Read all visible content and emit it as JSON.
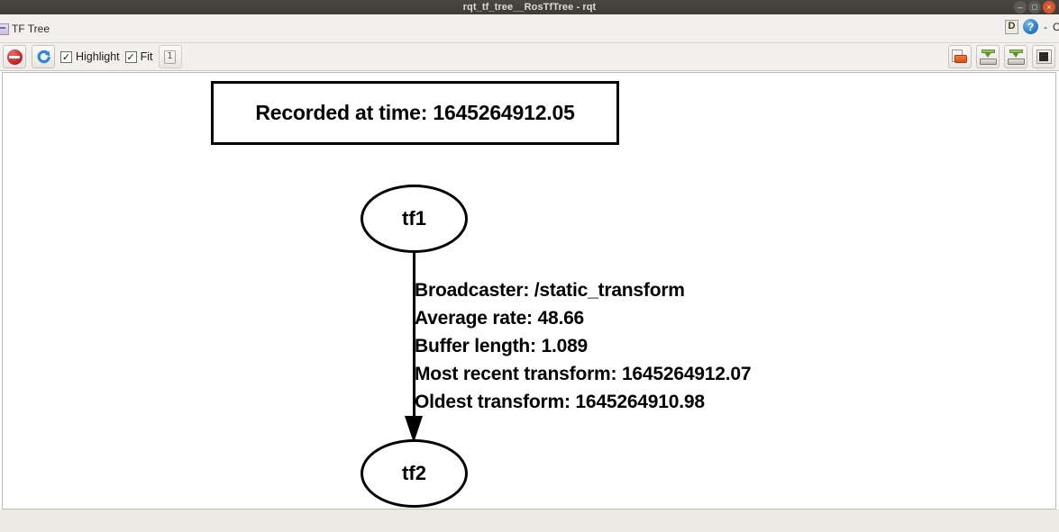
{
  "window": {
    "title": "rqt_tf_tree__RosTfTree - rqt",
    "controls": {
      "minimize": "–",
      "maximize": "□",
      "close": "×"
    }
  },
  "plugin_bar": {
    "tab_label": "TF Tree",
    "tab_icon": "plugin-icon",
    "dock_letter": "D",
    "help_icon": "?",
    "separator": "-",
    "trailing_text": "C"
  },
  "toolbar": {
    "left": [
      {
        "name": "stop-button",
        "icon": "stop-icon",
        "label": ""
      },
      {
        "name": "refresh-button",
        "icon": "refresh-icon",
        "label": ""
      }
    ],
    "highlight_checkbox": {
      "label": "Highlight",
      "checked": true,
      "mark": "✓"
    },
    "fit_checkbox": {
      "label": "Fit",
      "checked": true,
      "mark": "✓"
    },
    "zoom_one_button": {
      "label": "1",
      "icon": "zoom-one-icon"
    },
    "right": [
      {
        "name": "load-dot-button",
        "icon": "folder-open-icon"
      },
      {
        "name": "save-dot-button",
        "icon": "save-disk-icon"
      },
      {
        "name": "save-image-button",
        "icon": "save-disk-icon"
      },
      {
        "name": "save-raw-button",
        "icon": "filled-square-icon"
      }
    ]
  },
  "graph": {
    "time_box": {
      "text": "Recorded at time: 1645264912.05"
    },
    "nodes": [
      {
        "id": "tf1",
        "label": "tf1"
      },
      {
        "id": "tf2",
        "label": "tf2"
      }
    ],
    "edge": {
      "from": "tf1",
      "to": "tf2",
      "lines": [
        "Broadcaster: /static_transform",
        "Average rate: 48.66",
        "Buffer length: 1.089",
        "Most recent transform: 1645264912.07",
        "Oldest transform: 1645264910.98"
      ]
    }
  },
  "colors": {
    "titlebar_bg": "#3f3b37",
    "titlebar_text": "#dedad6",
    "chrome_bg": "#f2f0ed",
    "canvas_bg": "#ffffff",
    "graph_stroke": "#000000",
    "close_button": "#d8552b",
    "help_blue": "#2e7dc4",
    "stop_red": "#c42020"
  }
}
